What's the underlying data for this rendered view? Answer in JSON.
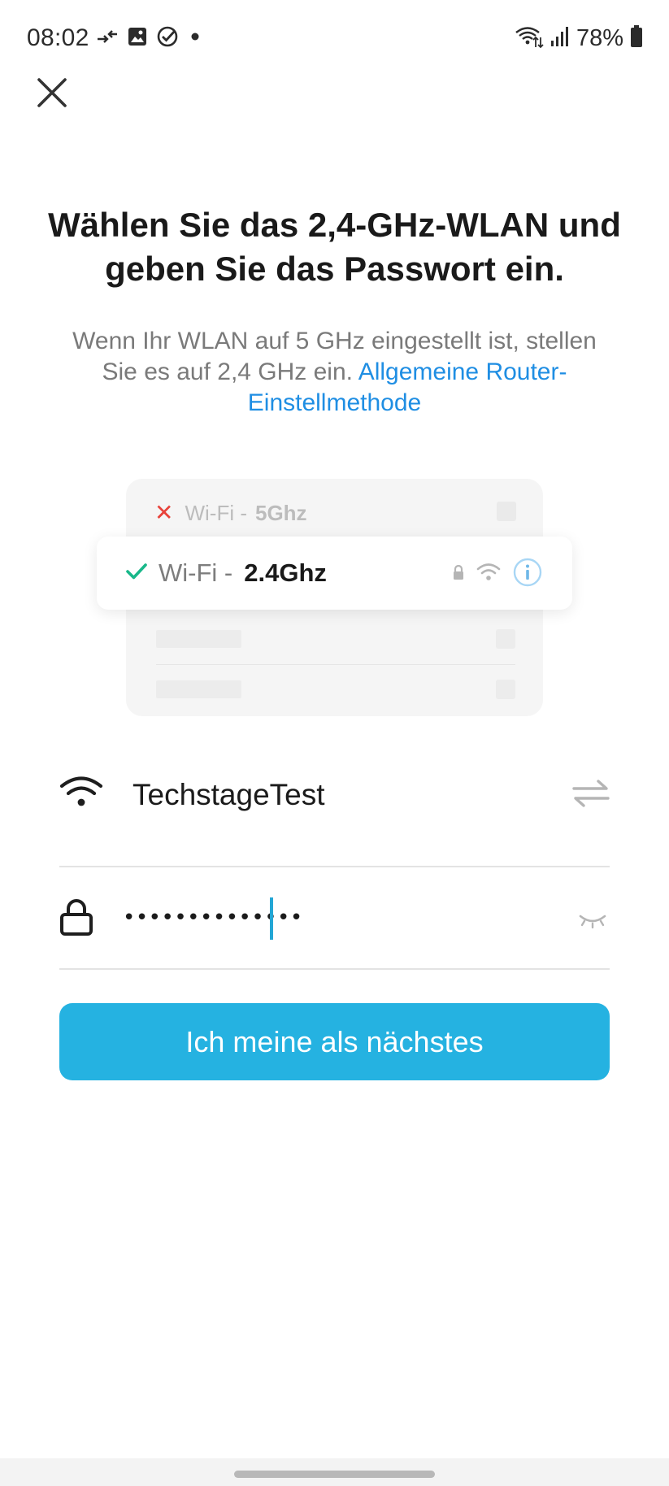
{
  "status_bar": {
    "time": "08:02",
    "battery": "78%",
    "left_icons": [
      "data-transfer-icon",
      "gallery-icon",
      "check-circle-icon",
      "notification-dot-icon"
    ],
    "right_icons": [
      "wifi-6-icon",
      "signal-icon",
      "battery-icon"
    ]
  },
  "header": {
    "close_icon": "close-icon"
  },
  "main": {
    "title": "Wählen Sie das 2,4-GHz-WLAN und geben Sie das Passwort ein.",
    "subtitle_text": "Wenn Ihr WLAN auf 5 GHz eingestellt ist, stellen Sie es auf 2,4 GHz ein.",
    "subtitle_link": "Allgemeine Router-Einstellmethode"
  },
  "illustration": {
    "row_5g": {
      "prefix": "Wi-Fi -",
      "band": "5Ghz",
      "status": "cross"
    },
    "row_24g": {
      "prefix": "Wi-Fi -",
      "band": "2.4Ghz",
      "status": "check"
    }
  },
  "form": {
    "ssid_value": "TechstageTest",
    "password_value": "••••••••••••••",
    "submit_label": "Ich meine als nächstes"
  },
  "colors": {
    "accent": "#25b2e1",
    "link": "#1f8ee3",
    "check": "#19b88a",
    "cross": "#e8423a"
  }
}
